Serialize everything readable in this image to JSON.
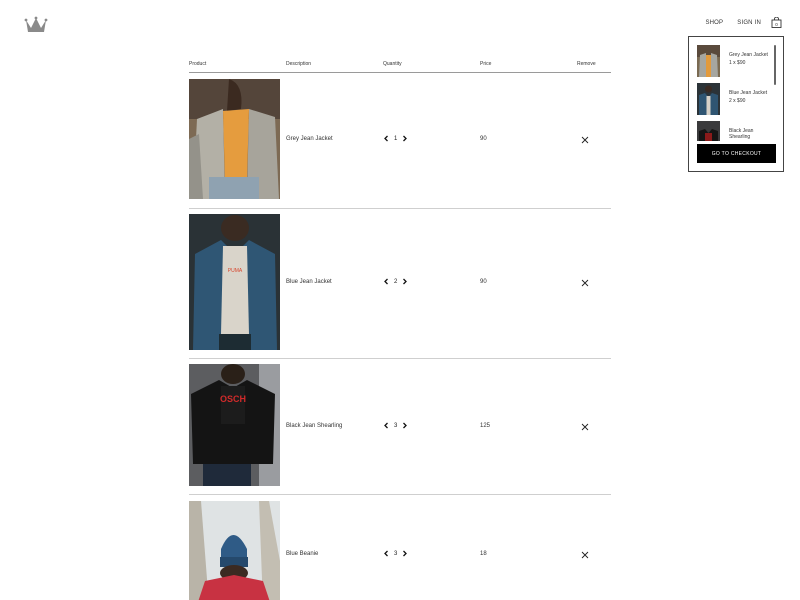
{
  "brand": {
    "logo_icon": "crown-icon"
  },
  "nav": {
    "shop": "SHOP",
    "signin": "SIGN IN",
    "bag_icon": "shopping-bag-icon"
  },
  "dropdown": {
    "items": [
      {
        "name": "Grey Jean Jacket",
        "qty": "1 x $90"
      },
      {
        "name": "Blue Jean Jacket",
        "qty": "2 x $90"
      },
      {
        "name": "Black Jean Shearling",
        "qty": ""
      }
    ],
    "checkout_label": "GO TO CHECKOUT"
  },
  "table": {
    "headers": {
      "product": "Product",
      "description": "Description",
      "quantity": "Quantity",
      "price": "Price",
      "remove": "Remove"
    },
    "rows": [
      {
        "name": "Grey Jean Jacket",
        "quantity": "1",
        "price": "90"
      },
      {
        "name": "Blue Jean Jacket",
        "quantity": "2",
        "price": "90"
      },
      {
        "name": "Black Jean Shearling",
        "quantity": "3",
        "price": "125"
      },
      {
        "name": "Blue Beanie",
        "quantity": "3",
        "price": "18"
      }
    ]
  },
  "colors": {
    "button_bg": "#000000",
    "divider": "#cfcfcf",
    "text": "#333333"
  }
}
